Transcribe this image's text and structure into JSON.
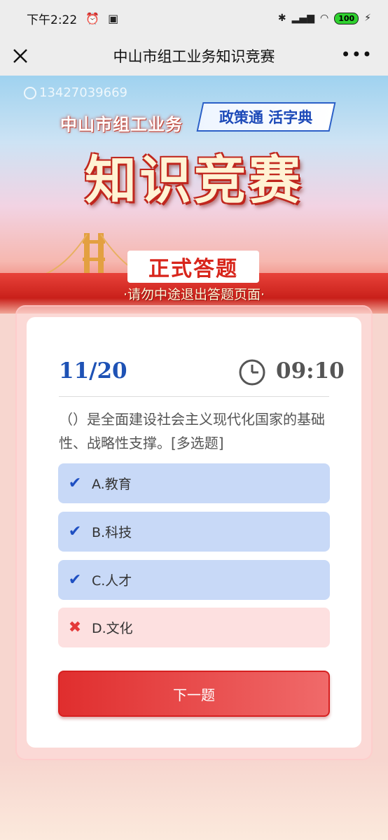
{
  "status_bar": {
    "time": "下午2:22",
    "battery": "100"
  },
  "title_bar": {
    "title": "中山市组工业务知识竞赛"
  },
  "banner": {
    "phone": "13427039669",
    "subtitle": "中山市组工业务",
    "pill": "政策通 活字典",
    "main_title": "知识竞赛",
    "formal": "正式答题",
    "warning": "·请勿中途退出答题页面·"
  },
  "quiz": {
    "progress": "11/20",
    "timer": "09:10",
    "question": "（）是全面建设社会主义现代化国家的基础性、战略性支撑。[多选题]",
    "options": [
      {
        "label": "A.教育",
        "state": "correct"
      },
      {
        "label": "B.科技",
        "state": "correct"
      },
      {
        "label": "C.人才",
        "state": "correct"
      },
      {
        "label": "D.文化",
        "state": "wrong"
      }
    ],
    "next_label": "下一题"
  },
  "colors": {
    "accent_blue": "#1e52b5",
    "accent_red": "#e02e2e",
    "option_selected": "#c8d9f7",
    "option_wrong": "#fde0e0"
  }
}
